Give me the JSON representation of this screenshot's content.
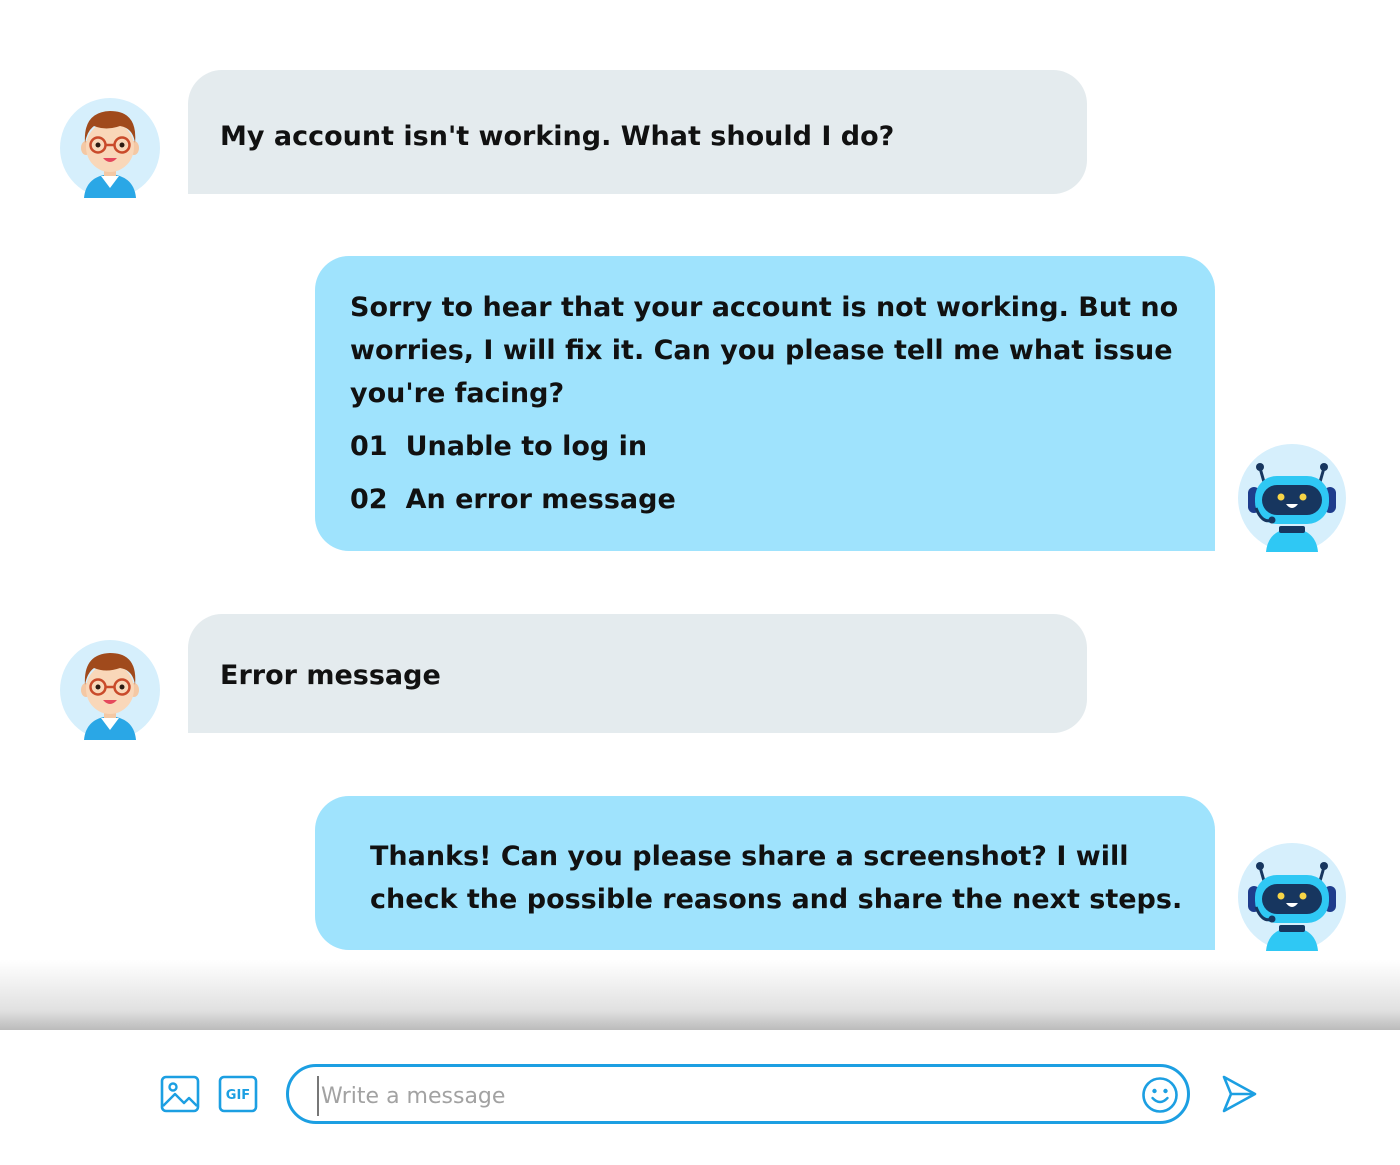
{
  "conversation": {
    "messages": [
      {
        "sender": "user",
        "text": "My account isn't working. What should I do?"
      },
      {
        "sender": "bot",
        "text": "Sorry to hear that your account is not working. But no worries, I will fix it.  Can you please tell me what issue you're facing?",
        "options": [
          {
            "number": "01",
            "label": "Unable to log in"
          },
          {
            "number": "02",
            "label": "An error message"
          }
        ]
      },
      {
        "sender": "user",
        "text": "Error message"
      },
      {
        "sender": "bot",
        "text": "Thanks! Can you please share a screenshot? I will check the possible reasons and share the next steps."
      }
    ]
  },
  "composer": {
    "placeholder": "Write a message",
    "gif_label": "GIF",
    "icons": [
      "image-icon",
      "gif-icon",
      "emoji-icon",
      "send-icon"
    ]
  },
  "colors": {
    "user_bubble": "#e4ebee",
    "bot_bubble": "#9fe3fd",
    "accent": "#1c9fe2"
  }
}
